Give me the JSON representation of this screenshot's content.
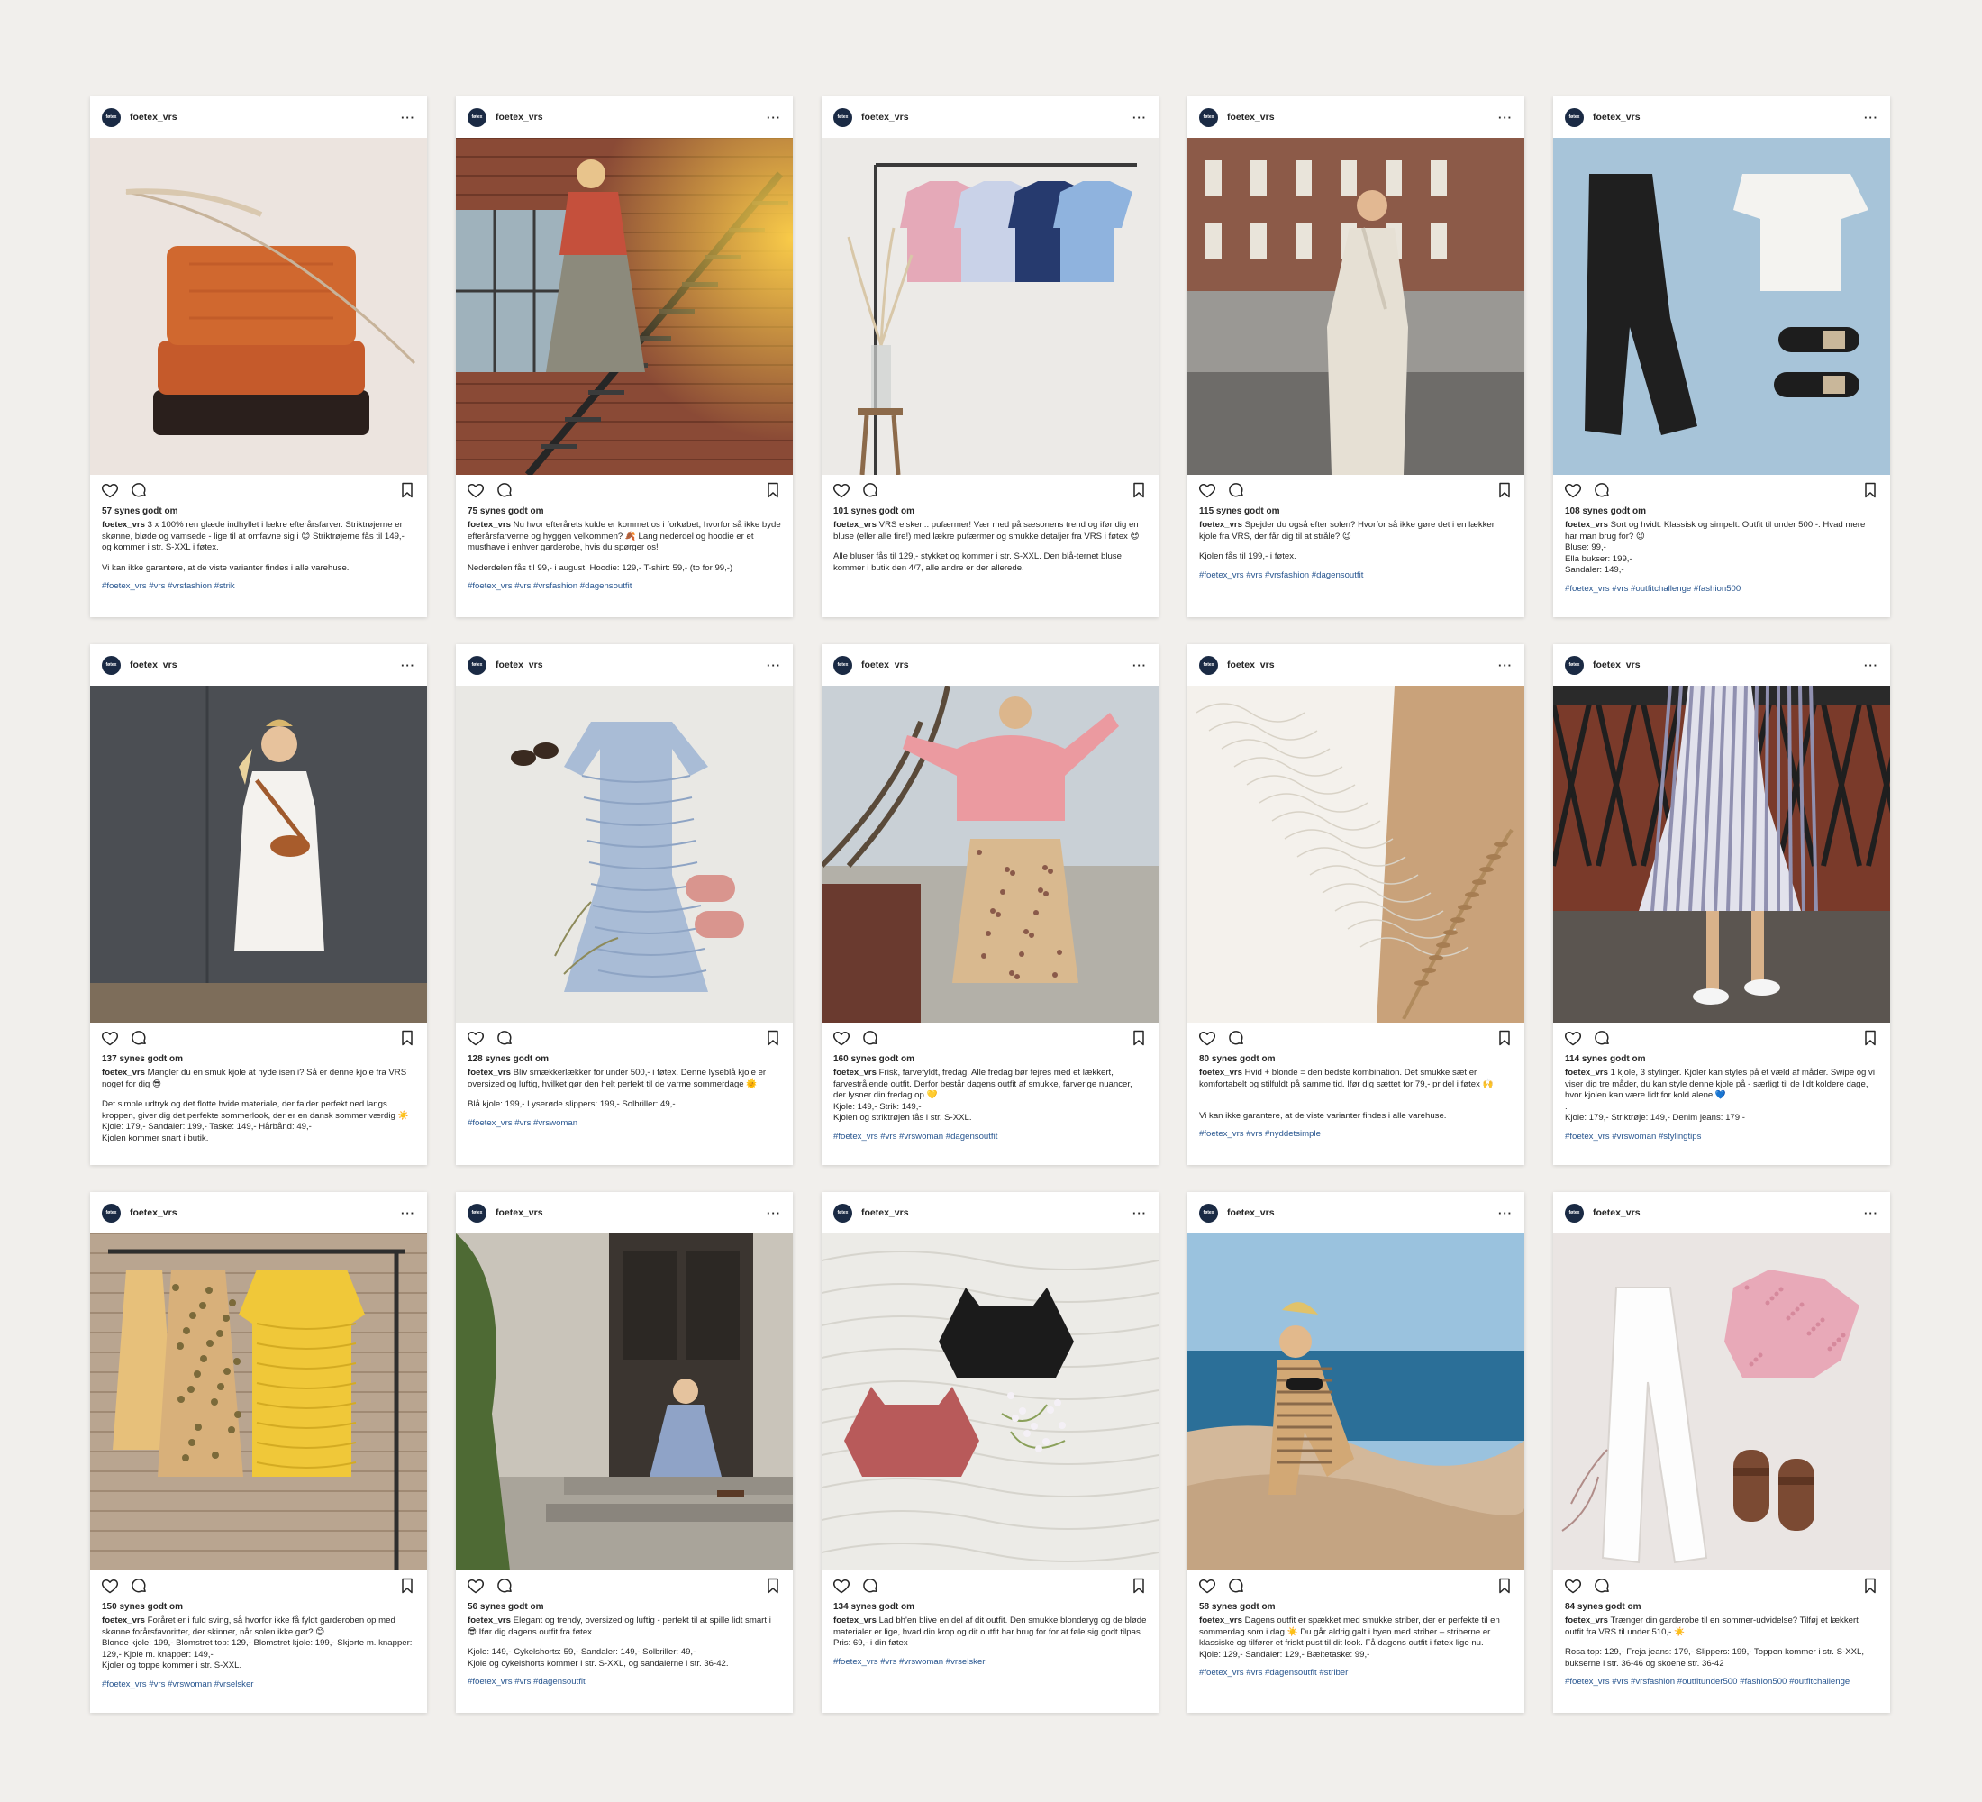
{
  "account": {
    "username": "foetex_vrs",
    "avatar_text": "føtex",
    "more_label": "···"
  },
  "colors": {
    "background": "#f1efec",
    "card": "#ffffff",
    "hashtag": "#27558f",
    "avatar": "#1a2a44"
  },
  "icons": [
    "heart-icon",
    "comment-icon",
    "bookmark-icon",
    "more-icon"
  ],
  "posts": [
    {
      "likes": "57 synes godt om",
      "caption_lead": "3 x 100% ren glæde indhyllet i lækre efterårsfarver. Striktrøjerne er skønne, bløde og vamsede - lige til at omfavne sig i 😊 Striktrøjerne fås til 149,- og kommer i str. S-XXL i føtex.",
      "caption_extra": [
        "Vi kan ikke garantere, at de viste varianter findes i alle varehuse."
      ],
      "hashtags": "#foetex_vrs #vrs #vrsfashion #strik",
      "scene": "sweaters"
    },
    {
      "likes": "75 synes godt om",
      "caption_lead": "Nu hvor efterårets kulde er kommet os i forkøbet, hvorfor så ikke byde efterårsfarverne og hyggen velkommen? 🍂 Lang nederdel og hoodie er et musthave i enhver garderobe, hvis du spørger os!",
      "caption_extra": [
        "Nederdelen fås til 99,- i august, Hoodie: 129,- T-shirt: 59,- (to for 99,-)"
      ],
      "hashtags": "#foetex_vrs #vrs #vrsfashion #dagensoutfit",
      "scene": "stairs"
    },
    {
      "likes": "101 synes godt om",
      "caption_lead": "VRS elsker... pufærmer! Vær med på sæsonens trend og ifør dig en bluse (eller alle fire!) med lækre pufærmer og smukke detaljer fra VRS i føtex 😍",
      "caption_extra": [
        "Alle bluser fås til 129,- stykket og kommer i str. S-XXL. Den blå-ternet bluse kommer i butik den 4/7, alle andre er der allerede."
      ],
      "hashtags": "",
      "scene": "blouses"
    },
    {
      "likes": "115 synes godt om",
      "caption_lead": "Spejder du også efter solen? Hvorfor så ikke gøre det i en lækker kjole fra VRS, der får dig til at stråle? 😉",
      "caption_extra": [
        "Kjolen fås til 199,- i føtex."
      ],
      "hashtags": "#foetex_vrs #vrs #vrsfashion #dagensoutfit",
      "scene": "wrapdress"
    },
    {
      "likes": "108 synes godt om",
      "caption_lead": "Sort og hvidt. Klassisk og simpelt. Outfit til under 500,-. Hvad mere har man brug for? 😉\nBluse: 99,-\nElla bukser: 199,-\nSandaler: 149,-",
      "caption_extra": [],
      "hashtags": "#foetex_vrs #vrs #outfitchallenge #fashion500",
      "scene": "flatlay-bw"
    },
    {
      "likes": "137 synes godt om",
      "caption_lead": "Mangler du en smuk kjole at nyde isen i? Så er denne kjole fra VRS noget for dig 😎",
      "caption_extra": [
        "Det simple udtryk og det flotte hvide materiale, der falder perfekt ned langs kroppen, giver dig det perfekte sommerlook, der er en dansk sommer værdig ☀️ Kjole: 179,- Sandaler: 199,- Taske: 149,- Hårbånd: 49,-\nKjolen kommer snart i butik."
      ],
      "hashtags": "",
      "scene": "whitedress"
    },
    {
      "likes": "128 synes godt om",
      "caption_lead": "Bliv smækkerlækker for under 500,- i føtex. Denne lyseblå kjole er oversized og luftig, hvilket gør den helt perfekt til de varme sommerdage 🌞",
      "caption_extra": [
        "Blå kjole: 199,- Lyserøde slippers: 199,- Solbriller: 49,-"
      ],
      "hashtags": "#foetex_vrs #vrs #vrswoman",
      "scene": "bluedress"
    },
    {
      "likes": "160 synes godt om",
      "caption_lead": "Frisk, farvefyldt, fredag. Alle fredag bør fejres med et lækkert, farvestrålende outfit. Derfor består dagens outfit af smukke, farverige nuancer, der lysner din fredag op 💛\nKjole: 149,- Strik: 149,-\nKjolen og striktrøjen fås i str. S-XXL.",
      "caption_extra": [],
      "hashtags": "#foetex_vrs #vrs #vrswoman #dagensoutfit",
      "scene": "pinksweater"
    },
    {
      "likes": "80 synes godt om",
      "caption_lead": "Hvid + blonde = den bedste kombination. Det smukke sæt er komfortabelt og stilfuldt på samme tid. Ifør dig sættet for 79,- pr del i føtex 🙌\n.",
      "caption_extra": [
        "Vi kan ikke garantere, at de viste varianter findes i alle varehuse."
      ],
      "hashtags": "#foetex_vrs #vrs #nyddetsimple",
      "scene": "lace"
    },
    {
      "likes": "114 synes godt om",
      "caption_lead": "1 kjole, 3 stylinger. Kjoler kan styles på et væld af måder. Swipe og vi viser dig tre måder, du kan style denne kjole på - særligt til de lidt koldere dage, hvor kjolen kan være lidt for kold alene 💙\n.\nKjole: 179,- Striktrøje: 149,- Denim jeans: 179,-",
      "caption_extra": [],
      "hashtags": "#foetex_vrs #vrswoman #stylingtips",
      "scene": "stripedress"
    },
    {
      "likes": "150 synes godt om",
      "caption_lead": "Foråret er i fuld sving, så hvorfor ikke få fyldt garderoben op med skønne forårsfavoritter, der skinner, når solen ikke gør? 😊\nBlonde kjole: 199,- Blomstret top: 129,- Blomstret kjole: 199,- Skjorte m. knapper: 129,- Kjole m. knapper: 149,-\nKjoler og toppe kommer i str. S-XXL.",
      "caption_extra": [],
      "hashtags": "#foetex_vrs #vrs #vrswoman #vrselsker",
      "scene": "rack-yellow"
    },
    {
      "likes": "56 synes godt om",
      "caption_lead": "Elegant og trendy, oversized og luftig - perfekt til at spille lidt smart i 😎 Ifør dig dagens outfit fra føtex.",
      "caption_extra": [
        "Kjole: 149,- Cykelshorts: 59,- Sandaler: 149,- Solbriller: 49,-\nKjole og cykelshorts kommer i str. S-XXL, og sandalerne i str. 36-42."
      ],
      "hashtags": "#foetex_vrs #vrs #dagensoutfit",
      "scene": "door"
    },
    {
      "likes": "134 synes godt om",
      "caption_lead": "Lad bh'en blive en del af dit outfit. Den smukke blonderyg og de bløde materialer er lige, hvad din krop og dit outfit har brug for for at føle sig godt tilpas.\nPris: 69,- i din føtex",
      "caption_extra": [],
      "hashtags": "#foetex_vrs #vrs #vrswoman #vrselsker",
      "scene": "bras"
    },
    {
      "likes": "58 synes godt om",
      "caption_lead": "Dagens outfit er spækket med smukke striber, der er perfekte til en sommerdag som i dag ☀️ Du går aldrig galt i byen med striber – striberne er klassiske og tilfører et friskt pust til dit look. Få dagens outfit i føtex lige nu.\nKjole: 129,- Sandaler: 129,- Bæltetaske: 99,-",
      "caption_extra": [],
      "hashtags": "#foetex_vrs #vrs #dagensoutfit #striber",
      "scene": "beach"
    },
    {
      "likes": "84 synes godt om",
      "caption_lead": "Trænger din garderobe til en sommer-udvidelse? Tilføj et lækkert outfit fra VRS til under 510,- ☀️",
      "caption_extra": [
        "Rosa top: 129,- Freja jeans: 179,- Slippers: 199,- Toppen kommer i str. S-XXL, bukserne i str. 36-46 og skoene str. 36-42"
      ],
      "hashtags": "#foetex_vrs #vrs #vrsfashion #outfitunder500 #fashion500 #outfitchallenge",
      "scene": "flatlay-pink"
    }
  ]
}
